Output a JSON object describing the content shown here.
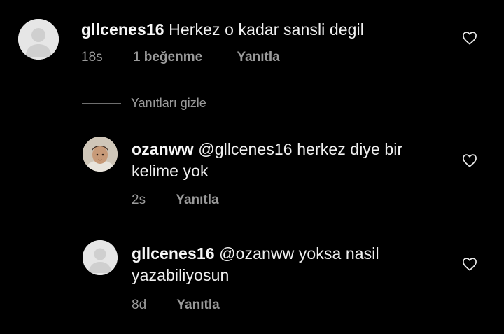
{
  "comments": [
    {
      "username": "gllcenes16",
      "text": "Herkez o kadar sansli degil",
      "time": "18s",
      "likes": "1 beğenme",
      "reply": "Yanıtla",
      "avatar": "default-avatar"
    }
  ],
  "hide_replies_label": "Yanıtları gizle",
  "replies": [
    {
      "username": "ozanww",
      "text_line1": "@gllcenes16 herkez diye bir",
      "text_line2": "kelime yok",
      "time": "2s",
      "reply": "Yanıtla",
      "avatar": "profile-photo"
    },
    {
      "username": "gllcenes16",
      "text_line1": "@ozanww yoksa nasil",
      "text_line2": "yazabiliyosun",
      "time": "8d",
      "reply": "Yanıtla",
      "avatar": "default-avatar"
    }
  ],
  "icons": {
    "like": "heart-outline-icon",
    "default_avatar": "person-silhouette-icon"
  },
  "colors": {
    "background": "#000000",
    "text": "#f0f0f0",
    "muted": "#9a9a9a"
  }
}
